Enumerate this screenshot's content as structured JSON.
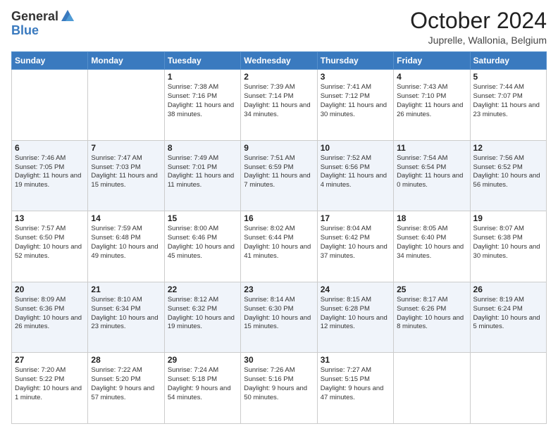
{
  "header": {
    "logo_general": "General",
    "logo_blue": "Blue",
    "month": "October 2024",
    "location": "Juprelle, Wallonia, Belgium"
  },
  "days_of_week": [
    "Sunday",
    "Monday",
    "Tuesday",
    "Wednesday",
    "Thursday",
    "Friday",
    "Saturday"
  ],
  "weeks": [
    [
      {
        "day": "",
        "sunrise": "",
        "sunset": "",
        "daylight": ""
      },
      {
        "day": "",
        "sunrise": "",
        "sunset": "",
        "daylight": ""
      },
      {
        "day": "1",
        "sunrise": "Sunrise: 7:38 AM",
        "sunset": "Sunset: 7:16 PM",
        "daylight": "Daylight: 11 hours and 38 minutes."
      },
      {
        "day": "2",
        "sunrise": "Sunrise: 7:39 AM",
        "sunset": "Sunset: 7:14 PM",
        "daylight": "Daylight: 11 hours and 34 minutes."
      },
      {
        "day": "3",
        "sunrise": "Sunrise: 7:41 AM",
        "sunset": "Sunset: 7:12 PM",
        "daylight": "Daylight: 11 hours and 30 minutes."
      },
      {
        "day": "4",
        "sunrise": "Sunrise: 7:43 AM",
        "sunset": "Sunset: 7:10 PM",
        "daylight": "Daylight: 11 hours and 26 minutes."
      },
      {
        "day": "5",
        "sunrise": "Sunrise: 7:44 AM",
        "sunset": "Sunset: 7:07 PM",
        "daylight": "Daylight: 11 hours and 23 minutes."
      }
    ],
    [
      {
        "day": "6",
        "sunrise": "Sunrise: 7:46 AM",
        "sunset": "Sunset: 7:05 PM",
        "daylight": "Daylight: 11 hours and 19 minutes."
      },
      {
        "day": "7",
        "sunrise": "Sunrise: 7:47 AM",
        "sunset": "Sunset: 7:03 PM",
        "daylight": "Daylight: 11 hours and 15 minutes."
      },
      {
        "day": "8",
        "sunrise": "Sunrise: 7:49 AM",
        "sunset": "Sunset: 7:01 PM",
        "daylight": "Daylight: 11 hours and 11 minutes."
      },
      {
        "day": "9",
        "sunrise": "Sunrise: 7:51 AM",
        "sunset": "Sunset: 6:59 PM",
        "daylight": "Daylight: 11 hours and 7 minutes."
      },
      {
        "day": "10",
        "sunrise": "Sunrise: 7:52 AM",
        "sunset": "Sunset: 6:56 PM",
        "daylight": "Daylight: 11 hours and 4 minutes."
      },
      {
        "day": "11",
        "sunrise": "Sunrise: 7:54 AM",
        "sunset": "Sunset: 6:54 PM",
        "daylight": "Daylight: 11 hours and 0 minutes."
      },
      {
        "day": "12",
        "sunrise": "Sunrise: 7:56 AM",
        "sunset": "Sunset: 6:52 PM",
        "daylight": "Daylight: 10 hours and 56 minutes."
      }
    ],
    [
      {
        "day": "13",
        "sunrise": "Sunrise: 7:57 AM",
        "sunset": "Sunset: 6:50 PM",
        "daylight": "Daylight: 10 hours and 52 minutes."
      },
      {
        "day": "14",
        "sunrise": "Sunrise: 7:59 AM",
        "sunset": "Sunset: 6:48 PM",
        "daylight": "Daylight: 10 hours and 49 minutes."
      },
      {
        "day": "15",
        "sunrise": "Sunrise: 8:00 AM",
        "sunset": "Sunset: 6:46 PM",
        "daylight": "Daylight: 10 hours and 45 minutes."
      },
      {
        "day": "16",
        "sunrise": "Sunrise: 8:02 AM",
        "sunset": "Sunset: 6:44 PM",
        "daylight": "Daylight: 10 hours and 41 minutes."
      },
      {
        "day": "17",
        "sunrise": "Sunrise: 8:04 AM",
        "sunset": "Sunset: 6:42 PM",
        "daylight": "Daylight: 10 hours and 37 minutes."
      },
      {
        "day": "18",
        "sunrise": "Sunrise: 8:05 AM",
        "sunset": "Sunset: 6:40 PM",
        "daylight": "Daylight: 10 hours and 34 minutes."
      },
      {
        "day": "19",
        "sunrise": "Sunrise: 8:07 AM",
        "sunset": "Sunset: 6:38 PM",
        "daylight": "Daylight: 10 hours and 30 minutes."
      }
    ],
    [
      {
        "day": "20",
        "sunrise": "Sunrise: 8:09 AM",
        "sunset": "Sunset: 6:36 PM",
        "daylight": "Daylight: 10 hours and 26 minutes."
      },
      {
        "day": "21",
        "sunrise": "Sunrise: 8:10 AM",
        "sunset": "Sunset: 6:34 PM",
        "daylight": "Daylight: 10 hours and 23 minutes."
      },
      {
        "day": "22",
        "sunrise": "Sunrise: 8:12 AM",
        "sunset": "Sunset: 6:32 PM",
        "daylight": "Daylight: 10 hours and 19 minutes."
      },
      {
        "day": "23",
        "sunrise": "Sunrise: 8:14 AM",
        "sunset": "Sunset: 6:30 PM",
        "daylight": "Daylight: 10 hours and 15 minutes."
      },
      {
        "day": "24",
        "sunrise": "Sunrise: 8:15 AM",
        "sunset": "Sunset: 6:28 PM",
        "daylight": "Daylight: 10 hours and 12 minutes."
      },
      {
        "day": "25",
        "sunrise": "Sunrise: 8:17 AM",
        "sunset": "Sunset: 6:26 PM",
        "daylight": "Daylight: 10 hours and 8 minutes."
      },
      {
        "day": "26",
        "sunrise": "Sunrise: 8:19 AM",
        "sunset": "Sunset: 6:24 PM",
        "daylight": "Daylight: 10 hours and 5 minutes."
      }
    ],
    [
      {
        "day": "27",
        "sunrise": "Sunrise: 7:20 AM",
        "sunset": "Sunset: 5:22 PM",
        "daylight": "Daylight: 10 hours and 1 minute."
      },
      {
        "day": "28",
        "sunrise": "Sunrise: 7:22 AM",
        "sunset": "Sunset: 5:20 PM",
        "daylight": "Daylight: 9 hours and 57 minutes."
      },
      {
        "day": "29",
        "sunrise": "Sunrise: 7:24 AM",
        "sunset": "Sunset: 5:18 PM",
        "daylight": "Daylight: 9 hours and 54 minutes."
      },
      {
        "day": "30",
        "sunrise": "Sunrise: 7:26 AM",
        "sunset": "Sunset: 5:16 PM",
        "daylight": "Daylight: 9 hours and 50 minutes."
      },
      {
        "day": "31",
        "sunrise": "Sunrise: 7:27 AM",
        "sunset": "Sunset: 5:15 PM",
        "daylight": "Daylight: 9 hours and 47 minutes."
      },
      {
        "day": "",
        "sunrise": "",
        "sunset": "",
        "daylight": ""
      },
      {
        "day": "",
        "sunrise": "",
        "sunset": "",
        "daylight": ""
      }
    ]
  ]
}
